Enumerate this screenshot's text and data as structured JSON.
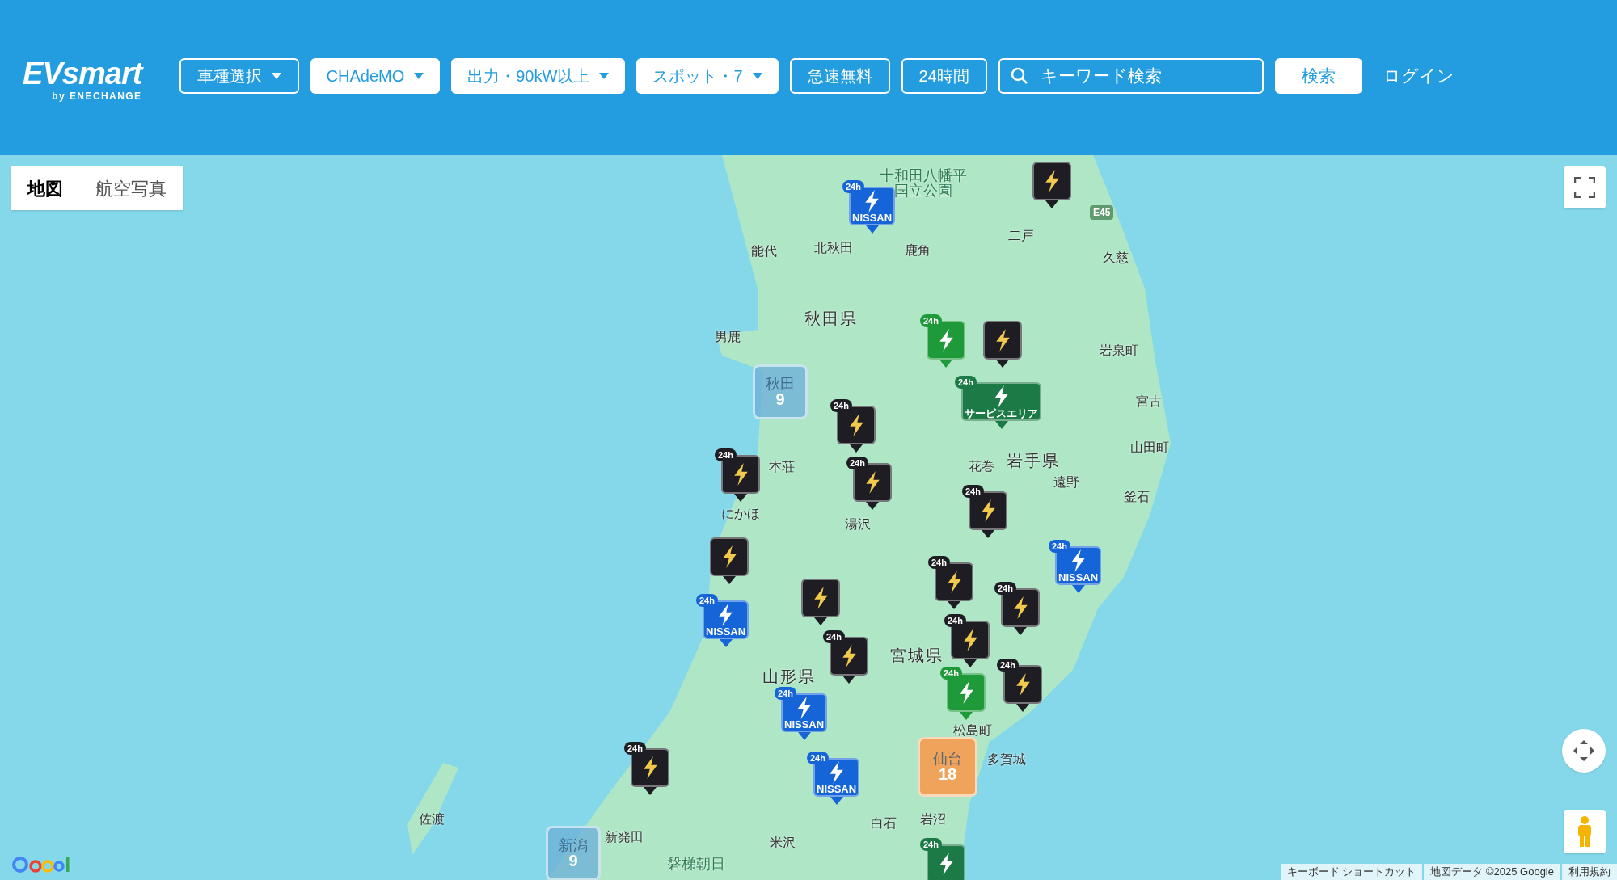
{
  "header": {
    "logo": {
      "brand": "EVsmart",
      "byline": "by ENECHANGE"
    },
    "filters": [
      {
        "label": "車種選択",
        "kind": "outline",
        "dropdown": true
      },
      {
        "label": "CHAdeMO",
        "kind": "solid",
        "dropdown": true
      },
      {
        "label": "出力・90kW以上",
        "kind": "solid",
        "dropdown": true
      },
      {
        "label": "スポット・7",
        "kind": "solid",
        "dropdown": true
      },
      {
        "label": "急速無料",
        "kind": "outline",
        "dropdown": false
      },
      {
        "label": "24時間",
        "kind": "outline",
        "dropdown": false
      }
    ],
    "search": {
      "placeholder": "キーワード検索"
    },
    "search_button": "検索",
    "login": "ログイン"
  },
  "map": {
    "type_toggle": [
      {
        "label": "地図",
        "selected": true
      },
      {
        "label": "航空写真",
        "selected": false
      }
    ],
    "places": [
      {
        "name": "十和田八幡平国立公園",
        "kind": "park"
      },
      {
        "name": "能代",
        "kind": "city"
      },
      {
        "name": "北秋田",
        "kind": "city"
      },
      {
        "name": "鹿角",
        "kind": "city"
      },
      {
        "name": "二戸",
        "kind": "city"
      },
      {
        "name": "久慈",
        "kind": "city"
      },
      {
        "name": "男鹿",
        "kind": "city"
      },
      {
        "name": "秋田県",
        "kind": "prefecture"
      },
      {
        "name": "岩泉町",
        "kind": "city"
      },
      {
        "name": "宮古",
        "kind": "city"
      },
      {
        "name": "山田町",
        "kind": "city"
      },
      {
        "name": "本荘",
        "kind": "city"
      },
      {
        "name": "花巻",
        "kind": "city"
      },
      {
        "name": "岩手県",
        "kind": "prefecture"
      },
      {
        "name": "遠野",
        "kind": "city"
      },
      {
        "name": "釜石",
        "kind": "city"
      },
      {
        "name": "にかほ",
        "kind": "city"
      },
      {
        "name": "湯沢",
        "kind": "city"
      },
      {
        "name": "山形県",
        "kind": "prefecture"
      },
      {
        "name": "宮城県",
        "kind": "prefecture"
      },
      {
        "name": "松島町",
        "kind": "city"
      },
      {
        "name": "多賀城",
        "kind": "city"
      },
      {
        "name": "佐渡",
        "kind": "city"
      },
      {
        "name": "新発田",
        "kind": "city"
      },
      {
        "name": "磐梯朝日",
        "kind": "park"
      },
      {
        "name": "米沢",
        "kind": "city"
      },
      {
        "name": "白石",
        "kind": "city"
      },
      {
        "name": "岩沼",
        "kind": "city"
      }
    ],
    "road_shield": "E45",
    "markers": [
      {
        "kind": "nissan",
        "badge": "24h",
        "brand": "NISSAN"
      },
      {
        "kind": "standard"
      },
      {
        "kind": "green",
        "badge": "24h"
      },
      {
        "kind": "standard"
      },
      {
        "kind": "standard",
        "badge": "24h"
      },
      {
        "kind": "service_area",
        "badge": "24h",
        "brand": "サービスエリア"
      },
      {
        "kind": "standard",
        "badge": "24h"
      },
      {
        "kind": "standard",
        "badge": "24h"
      },
      {
        "kind": "standard",
        "badge": "24h"
      },
      {
        "kind": "standard"
      },
      {
        "kind": "standard",
        "badge": "24h"
      },
      {
        "kind": "nissan",
        "badge": "24h",
        "brand": "NISSAN"
      },
      {
        "kind": "nissan",
        "badge": "24h",
        "brand": "NISSAN"
      },
      {
        "kind": "standard"
      },
      {
        "kind": "standard",
        "badge": "24h"
      },
      {
        "kind": "standard",
        "badge": "24h"
      },
      {
        "kind": "standard",
        "badge": "24h"
      },
      {
        "kind": "nissan",
        "badge": "24h",
        "brand": "NISSAN"
      },
      {
        "kind": "green",
        "badge": "24h"
      },
      {
        "kind": "standard",
        "badge": "24h"
      },
      {
        "kind": "standard",
        "badge": "24h"
      },
      {
        "kind": "nissan",
        "badge": "24h",
        "brand": "NISSAN"
      },
      {
        "kind": "service_area",
        "badge": "24h"
      }
    ],
    "clusters": [
      {
        "name": "秋田",
        "count": "9",
        "kind": "small"
      },
      {
        "name": "仙台",
        "count": "18",
        "kind": "large"
      },
      {
        "name": "新潟",
        "count": "9",
        "kind": "small"
      }
    ],
    "attribution": [
      "キーボード ショートカット",
      "地図データ ©2025 Google",
      "利用規約"
    ]
  }
}
